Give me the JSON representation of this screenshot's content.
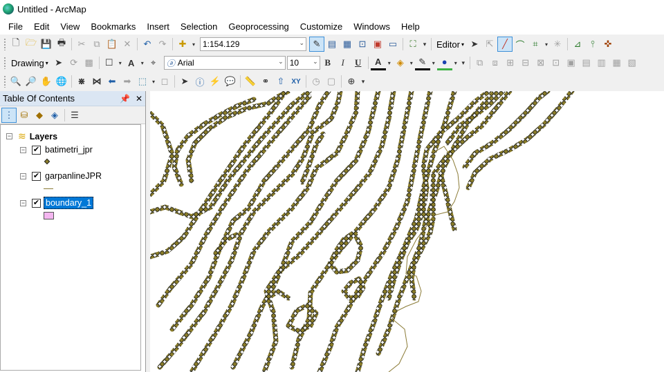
{
  "window": {
    "title": "Untitled - ArcMap"
  },
  "menu": [
    "File",
    "Edit",
    "View",
    "Bookmarks",
    "Insert",
    "Selection",
    "Geoprocessing",
    "Customize",
    "Windows",
    "Help"
  ],
  "toolbar": {
    "scale_value": "1:154.129",
    "editor_label": "Editor",
    "drawing_label": "Drawing",
    "font_name": "Arial",
    "font_size": "10",
    "bold": "B",
    "italic": "I",
    "underline": "U",
    "font_color_glyph": "A",
    "text_tool_glyph": "A",
    "xy_label": "XY"
  },
  "colors": {
    "accent_selection": "#0078d7",
    "contour_fill": "#8b7d2a",
    "contour_stroke": "#1a1a0a",
    "boundary_line": "#8a7a35",
    "boundary_swatch": "#f4b6f0"
  },
  "toc": {
    "title": "Table Of Contents",
    "pin": "ᵖ",
    "close": "✕",
    "root_label": "Layers",
    "layers": [
      {
        "name": "batimetri_jpr",
        "checked": true,
        "symbol": "point",
        "selected": false
      },
      {
        "name": "garpanlineJPR",
        "checked": true,
        "symbol": "line",
        "selected": false
      },
      {
        "name": "boundary_1",
        "checked": true,
        "symbol": "polygon",
        "selected": true
      }
    ]
  }
}
